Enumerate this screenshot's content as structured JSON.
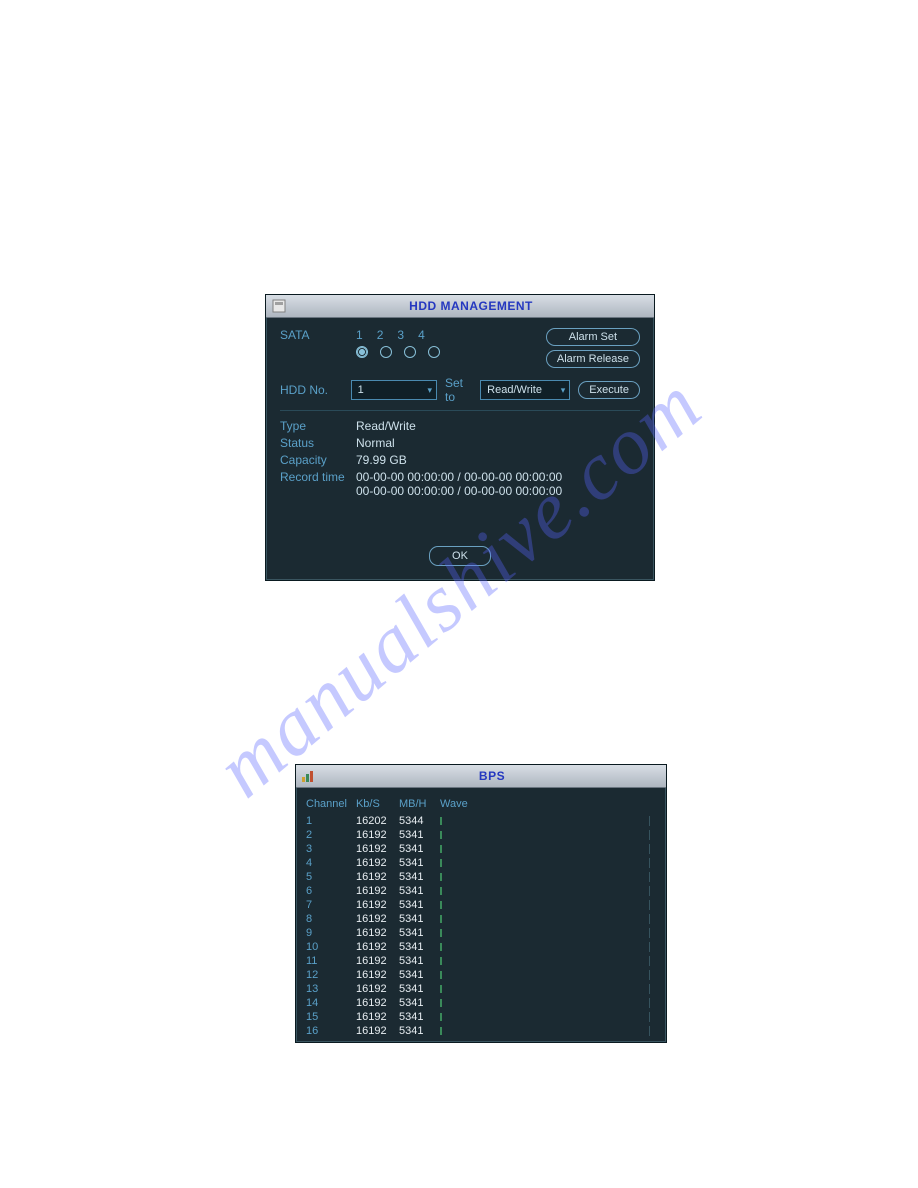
{
  "watermark": "manualshive.com",
  "hdd": {
    "title": "HDD MANAGEMENT",
    "labels": {
      "sata": "SATA",
      "hdd_no": "HDD No.",
      "set_to": "Set to",
      "type": "Type",
      "status": "Status",
      "capacity": "Capacity",
      "record_time": "Record time"
    },
    "sata_ports": [
      "1",
      "2",
      "3",
      "4"
    ],
    "sata_selected_index": 0,
    "hdd_no_value": "1",
    "set_to_value": "Read/Write",
    "buttons": {
      "alarm_set": "Alarm Set",
      "alarm_release": "Alarm Release",
      "execute": "Execute",
      "ok": "OK"
    },
    "info": {
      "type": "Read/Write",
      "status": "Normal",
      "capacity": "79.99 GB",
      "record_time_1": "00-00-00 00:00:00 / 00-00-00 00:00:00",
      "record_time_2": "00-00-00 00:00:00 / 00-00-00 00:00:00"
    }
  },
  "bps": {
    "title": "BPS",
    "columns": {
      "channel": "Channel",
      "kbs": "Kb/S",
      "mbh": "MB/H",
      "wave": "Wave"
    },
    "rows": [
      {
        "ch": "1",
        "kbs": "16202",
        "mbh": "5344"
      },
      {
        "ch": "2",
        "kbs": "16192",
        "mbh": "5341"
      },
      {
        "ch": "3",
        "kbs": "16192",
        "mbh": "5341"
      },
      {
        "ch": "4",
        "kbs": "16192",
        "mbh": "5341"
      },
      {
        "ch": "5",
        "kbs": "16192",
        "mbh": "5341"
      },
      {
        "ch": "6",
        "kbs": "16192",
        "mbh": "5341"
      },
      {
        "ch": "7",
        "kbs": "16192",
        "mbh": "5341"
      },
      {
        "ch": "8",
        "kbs": "16192",
        "mbh": "5341"
      },
      {
        "ch": "9",
        "kbs": "16192",
        "mbh": "5341"
      },
      {
        "ch": "10",
        "kbs": "16192",
        "mbh": "5341"
      },
      {
        "ch": "11",
        "kbs": "16192",
        "mbh": "5341"
      },
      {
        "ch": "12",
        "kbs": "16192",
        "mbh": "5341"
      },
      {
        "ch": "13",
        "kbs": "16192",
        "mbh": "5341"
      },
      {
        "ch": "14",
        "kbs": "16192",
        "mbh": "5341"
      },
      {
        "ch": "15",
        "kbs": "16192",
        "mbh": "5341"
      },
      {
        "ch": "16",
        "kbs": "16192",
        "mbh": "5341"
      }
    ]
  }
}
